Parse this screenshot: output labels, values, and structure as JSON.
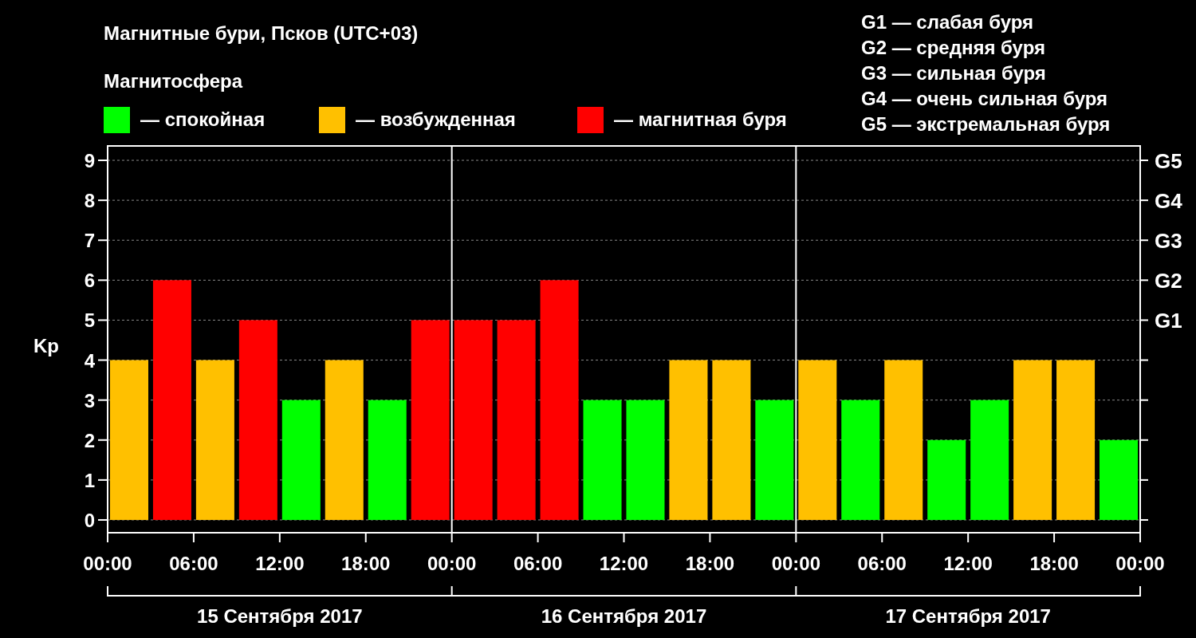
{
  "title": "Магнитные бури, Псков (UTC+03)",
  "legend_title": "Магнитосфера",
  "legend_prefix": "—",
  "scale": [
    "G1 — слабая буря",
    "G2 — средняя буря",
    "G3 — сильная буря",
    "G4 — очень сильная буря",
    "G5 — экстремальная буря"
  ],
  "chart": {
    "right_ticks": [
      "G5",
      "G4",
      "G3",
      "G2",
      "G1"
    ],
    "x_axis_labels": [
      "00:00",
      "06:00",
      "12:00",
      "18:00",
      "00:00",
      "06:00",
      "12:00",
      "18:00",
      "00:00",
      "06:00",
      "12:00",
      "18:00",
      "00:00"
    ],
    "days": [
      "15 Сентября 2017",
      "16 Сентября 2017",
      "17 Сентября 2017"
    ],
    "chart_data": {
      "type": "bar",
      "ylabel": "Kp",
      "stacked": true,
      "grid": true,
      "series": [
        {
          "name": "спокойная",
          "color": "#00ff00",
          "values": [
            null,
            null,
            null,
            null,
            3,
            null,
            3,
            null,
            null,
            null,
            null,
            3,
            3,
            null,
            null,
            3,
            null,
            3,
            null,
            2,
            3,
            null,
            null,
            2
          ]
        },
        {
          "name": "возбужденная",
          "color": "#ffc000",
          "values": [
            4,
            null,
            4,
            null,
            null,
            4,
            null,
            null,
            null,
            null,
            null,
            null,
            null,
            4,
            4,
            null,
            4,
            null,
            4,
            null,
            null,
            4,
            4,
            null
          ]
        },
        {
          "name": "магнитная буря",
          "color": "#ff0000",
          "values": [
            null,
            6,
            null,
            5,
            null,
            null,
            null,
            5,
            5,
            5,
            6,
            null,
            null,
            null,
            null,
            null,
            null,
            null,
            null,
            null,
            null,
            null,
            null,
            null
          ]
        }
      ],
      "ylim": [
        -0.32,
        9.36
      ],
      "yticks": [
        0,
        1,
        2,
        3,
        4,
        5,
        6,
        7,
        8,
        9
      ]
    }
  }
}
